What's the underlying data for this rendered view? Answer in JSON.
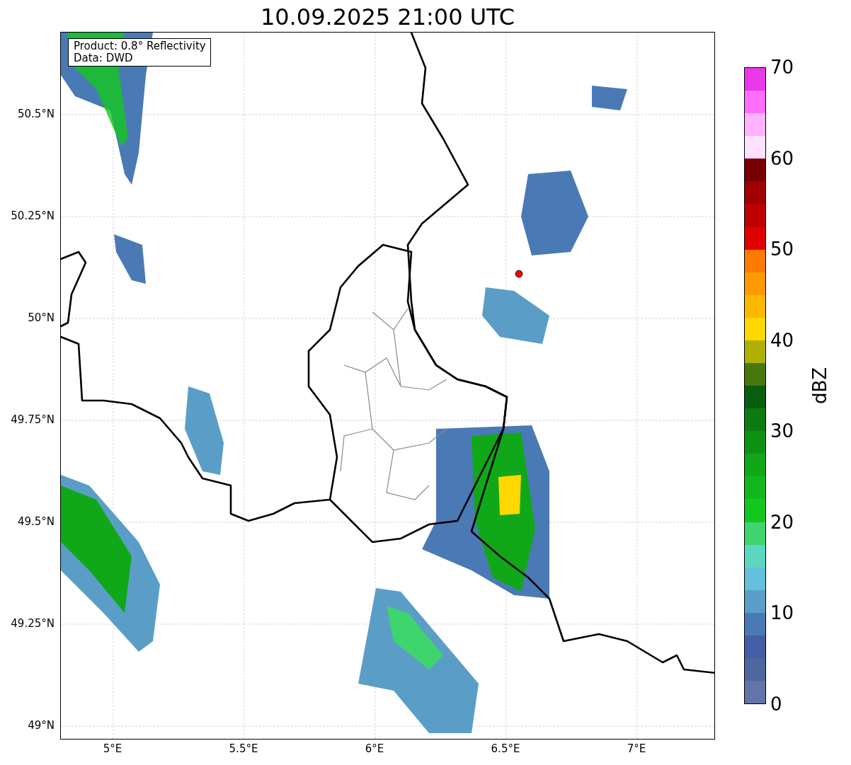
{
  "title": "10.09.2025 21:00 UTC",
  "map": {
    "info_box": [
      "Product: 0.8° Reflectivity",
      "Data: DWD"
    ],
    "y_ticks": [
      "50.5°N",
      "50.25°N",
      "50°N",
      "49.75°N",
      "49.5°N",
      "49.25°N",
      "49°N"
    ],
    "x_ticks": [
      "5°E",
      "5.5°E",
      "6°E",
      "6.5°E",
      "7°E"
    ]
  },
  "colorbar": {
    "label": "dBZ",
    "ticks": [
      "70",
      "60",
      "50",
      "40",
      "30",
      "20",
      "10",
      "0"
    ],
    "steps": [
      {
        "color": "#e838e8"
      },
      {
        "color": "#ff6eff"
      },
      {
        "color": "#ffb2ff"
      },
      {
        "color": "#ffe0ff"
      },
      {
        "color": "#780000"
      },
      {
        "color": "#a00000"
      },
      {
        "color": "#c00000"
      },
      {
        "color": "#e00000"
      },
      {
        "color": "#ff7a00"
      },
      {
        "color": "#ff9a00"
      },
      {
        "color": "#ffb800"
      },
      {
        "color": "#ffd800"
      },
      {
        "color": "#b0b004"
      },
      {
        "color": "#46780e"
      },
      {
        "color": "#085e0c"
      },
      {
        "color": "#0c7c12"
      },
      {
        "color": "#0e9216"
      },
      {
        "color": "#10a818"
      },
      {
        "color": "#10b81c"
      },
      {
        "color": "#12c81e"
      },
      {
        "color": "#3ed46e"
      },
      {
        "color": "#5ed6c2"
      },
      {
        "color": "#66c0dc"
      },
      {
        "color": "#5a9ec8"
      },
      {
        "color": "#4a7ab6"
      },
      {
        "color": "#425ea4"
      },
      {
        "color": "#50669e"
      },
      {
        "color": "#6474a8"
      }
    ]
  }
}
